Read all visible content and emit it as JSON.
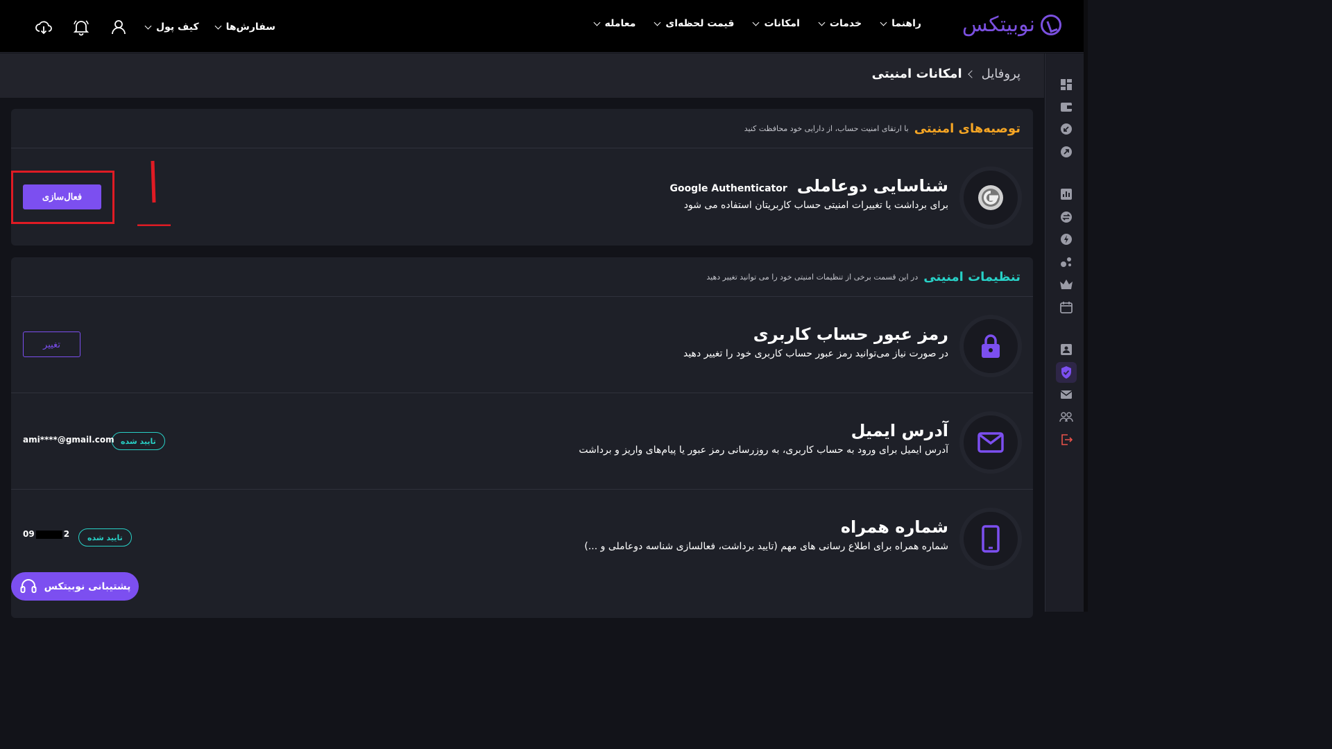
{
  "brand": {
    "name": "نوبیتکس",
    "accent": "#7c4ff0"
  },
  "nav": {
    "items": [
      "معامله",
      "قیمت لحظه‌ای",
      "امکانات",
      "خدمات",
      "راهنما"
    ],
    "orders_label": "سفارش‌ها",
    "wallet_label": "کیف پول"
  },
  "breadcrumb": {
    "parent": "پروفایل",
    "current": "امکانات امنیتی"
  },
  "recommendations": {
    "title": "توصیه‌های امنیتی",
    "subtitle": "با ارتقای امنیت حساب، از دارایی خود محافظت کنید",
    "two_factor": {
      "title": "شناسایی دوعاملی",
      "tag": "Google Authenticator",
      "desc": "برای برداشت یا تغییرات امنیتی حساب کاربریتان استفاده می شود",
      "button": "فعال‌سازی"
    }
  },
  "settings": {
    "title": "تنظیمات امنیتی",
    "subtitle": "در این قسمت برخی از تنظیمات امنیتی خود را می توانید تغییر دهید",
    "password": {
      "title": "رمز عبور حساب کاربری",
      "desc": "در صورت نیاز می‌توانید رمز عبور حساب کاربری خود را تغییر دهید",
      "button": "تغییر"
    },
    "email": {
      "title": "آدرس ایمیل",
      "desc": "آدرس ایمیل برای ورود به حساب کاربری، به روزرسانی رمز عبور یا پیام‌های واریز و برداشت",
      "status": "تایید شده",
      "value": "ami****@gmail.com"
    },
    "phone": {
      "title": "شماره همراه",
      "desc": "شماره همراه برای اطلاع رسانی های مهم (تایید برداشت، فعالسازی شناسه دوعاملی و ...)",
      "status": "تایید شده",
      "value_start": "09",
      "value_end": "2"
    }
  },
  "support": {
    "label": "پشتیبانی نوبیتکس"
  }
}
